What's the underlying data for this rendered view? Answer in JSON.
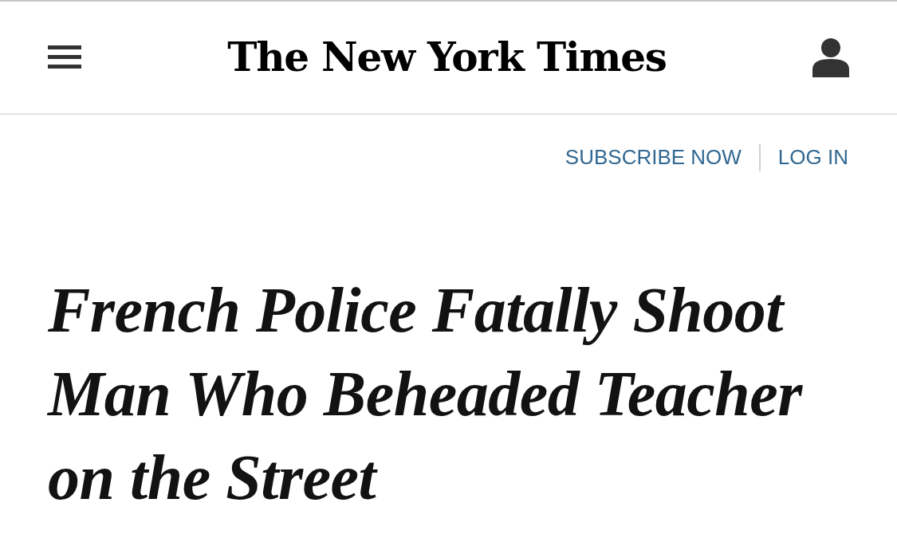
{
  "header": {
    "logo": "The New York Times"
  },
  "account_links": [
    {
      "label": "SUBSCRIBE NOW"
    },
    {
      "label": "LOG IN"
    }
  ],
  "headline": "French Police Fatally Shoot Man Who Beheaded Teacher on the Street"
}
